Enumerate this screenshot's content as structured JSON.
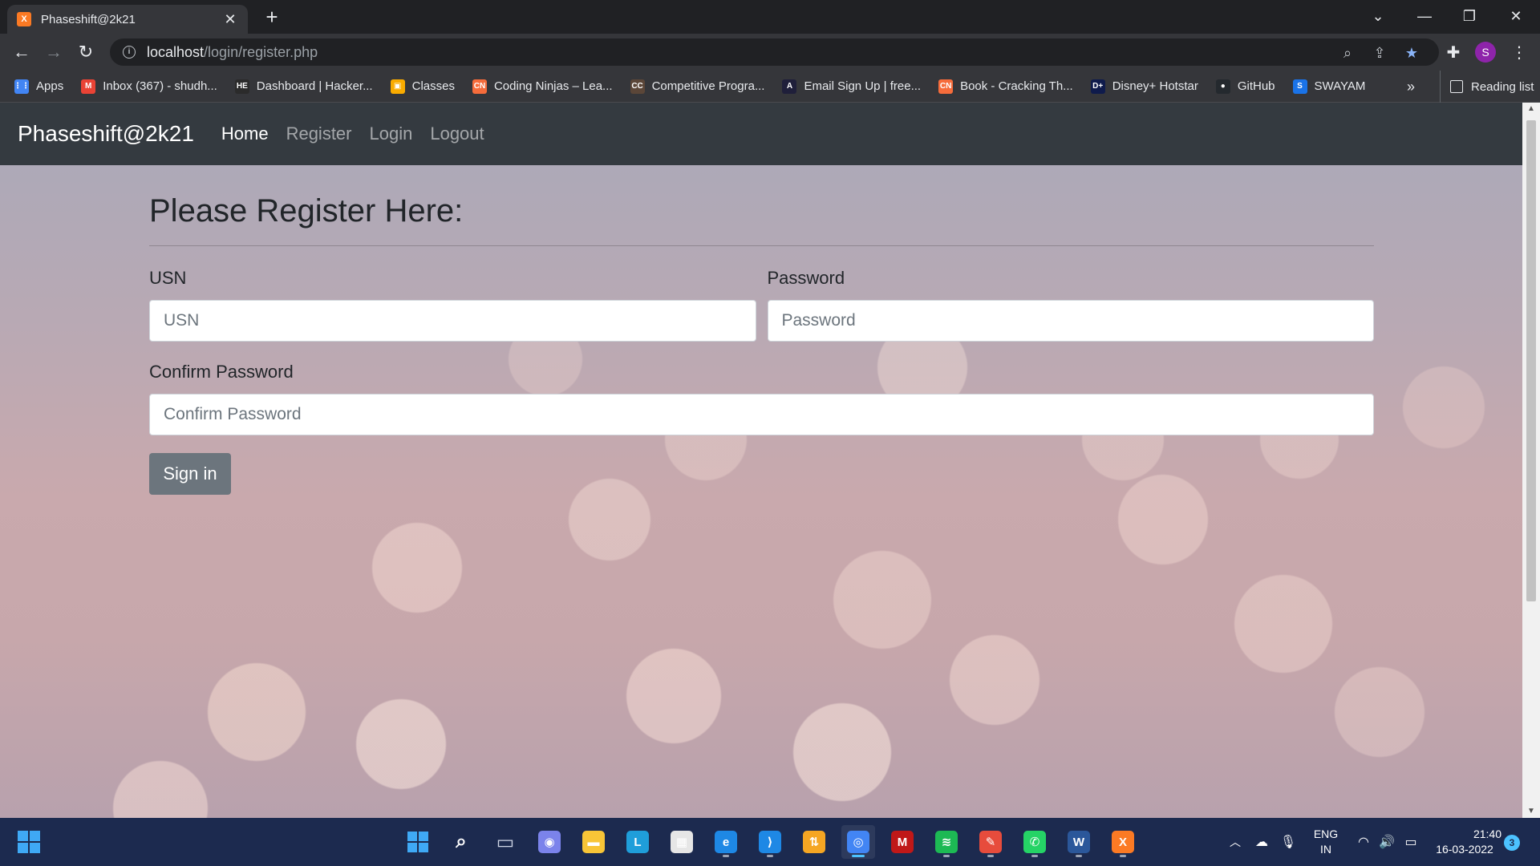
{
  "browser": {
    "tab_title": "Phaseshift@2k21",
    "tab_close": "✕",
    "new_tab": "+",
    "url_host": "localhost",
    "url_path": "/login/register.php",
    "profile_initial": "S",
    "bookmarks": [
      {
        "label": "Apps",
        "icon": "apps-grid-icon",
        "color": "#4285f4",
        "glyph": "⋮⋮"
      },
      {
        "label": "Inbox (367) - shudh...",
        "icon": "gmail-icon",
        "color": "#ea4335",
        "glyph": "M"
      },
      {
        "label": "Dashboard | Hacker...",
        "icon": "hackerearth-icon",
        "color": "#2b2b2b",
        "glyph": "HE"
      },
      {
        "label": "Classes",
        "icon": "google-classroom-icon",
        "color": "#f9ab00",
        "glyph": "▣"
      },
      {
        "label": "Coding Ninjas – Lea...",
        "icon": "coding-ninjas-icon",
        "color": "#f66c3b",
        "glyph": "CN"
      },
      {
        "label": "Competitive Progra...",
        "icon": "codechef-icon",
        "color": "#5b4638",
        "glyph": "CC"
      },
      {
        "label": "Email Sign Up | free...",
        "icon": "email-signup-icon",
        "color": "#1f1f3a",
        "glyph": "A"
      },
      {
        "label": "Book - Cracking Th...",
        "icon": "coding-ninjas-book-icon",
        "color": "#f66c3b",
        "glyph": "CN"
      },
      {
        "label": "Disney+ Hotstar",
        "icon": "hotstar-icon",
        "color": "#0f1b4c",
        "glyph": "D+"
      },
      {
        "label": "GitHub",
        "icon": "github-icon",
        "color": "#24292e",
        "glyph": "●"
      },
      {
        "label": "SWAYAM",
        "icon": "swayam-icon",
        "color": "#1a73e8",
        "glyph": "S"
      }
    ],
    "bookmarks_more": "»",
    "reading_list": "Reading list"
  },
  "site": {
    "brand": "Phaseshift@2k21",
    "nav": [
      "Home",
      "Register",
      "Login",
      "Logout"
    ],
    "heading": "Please Register Here:",
    "usn_label": "USN",
    "usn_placeholder": "USN",
    "password_label": "Password",
    "password_placeholder": "Password",
    "confirm_label": "Confirm Password",
    "confirm_placeholder": "Confirm Password",
    "submit": "Sign in"
  },
  "taskbar": {
    "apps": [
      {
        "name": "windows-start",
        "color": "#3fa9f5"
      },
      {
        "name": "search-icon",
        "color": "#ffffff",
        "glyph": "⌕"
      },
      {
        "name": "task-view-icon",
        "color": "#cfd6e6",
        "glyph": "▭"
      },
      {
        "name": "teams-chat-icon",
        "color": "#7b83eb",
        "glyph": "◉"
      },
      {
        "name": "file-explorer-icon",
        "color": "#f8c537",
        "glyph": "▬"
      },
      {
        "name": "lucidchart-icon",
        "color": "#1f9eda",
        "glyph": "L"
      },
      {
        "name": "microsoft-store-icon",
        "color": "#e6e6e6",
        "glyph": "▦"
      },
      {
        "name": "edge-icon",
        "color": "#1e88e5",
        "glyph": "e"
      },
      {
        "name": "vscode-icon",
        "color": "#1e88e5",
        "glyph": "⟩"
      },
      {
        "name": "git-icon",
        "color": "#f5a623",
        "glyph": "⇅"
      },
      {
        "name": "chrome-icon",
        "color": "#4285f4",
        "glyph": "◎"
      },
      {
        "name": "mcafee-icon",
        "color": "#c01818",
        "glyph": "M"
      },
      {
        "name": "spotify-icon",
        "color": "#1db954",
        "glyph": "≋"
      },
      {
        "name": "paint-icon",
        "color": "#e74c3c",
        "glyph": "✎"
      },
      {
        "name": "whatsapp-icon",
        "color": "#25d366",
        "glyph": "✆"
      },
      {
        "name": "word-icon",
        "color": "#2b579a",
        "glyph": "W"
      },
      {
        "name": "xampp-icon",
        "color": "#fb7a24",
        "glyph": "X"
      }
    ],
    "lang_top": "ENG",
    "lang_bottom": "IN",
    "time": "21:40",
    "date": "16-03-2022",
    "notifications": "3"
  }
}
